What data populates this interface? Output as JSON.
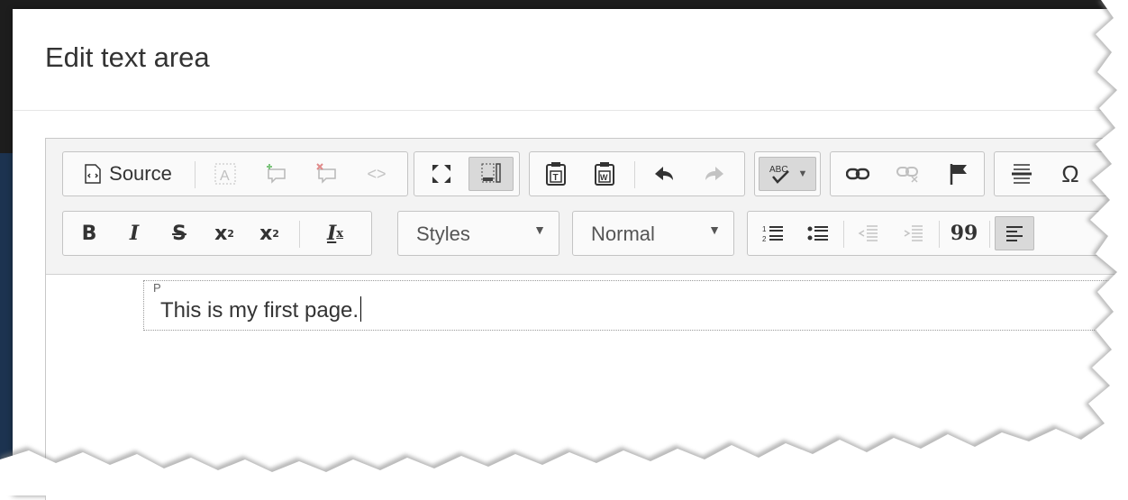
{
  "dialog": {
    "title": "Edit text area"
  },
  "toolbar": {
    "source_label": "Source",
    "styles": {
      "selected": "Styles"
    },
    "format": {
      "selected": "Normal"
    },
    "bold_label": "B",
    "italic_label": "I",
    "strike_label": "S",
    "subscript_label": "x",
    "subscript_sub": "2",
    "superscript_label": "x",
    "superscript_sup": "2",
    "remove_format_label": "I",
    "remove_format_sub": "x",
    "special_char_label": "Ω",
    "spell_label": "ABC",
    "blockquote_label": "99"
  },
  "content": {
    "element_tag": "P",
    "paragraph_text": "This is my first page."
  }
}
